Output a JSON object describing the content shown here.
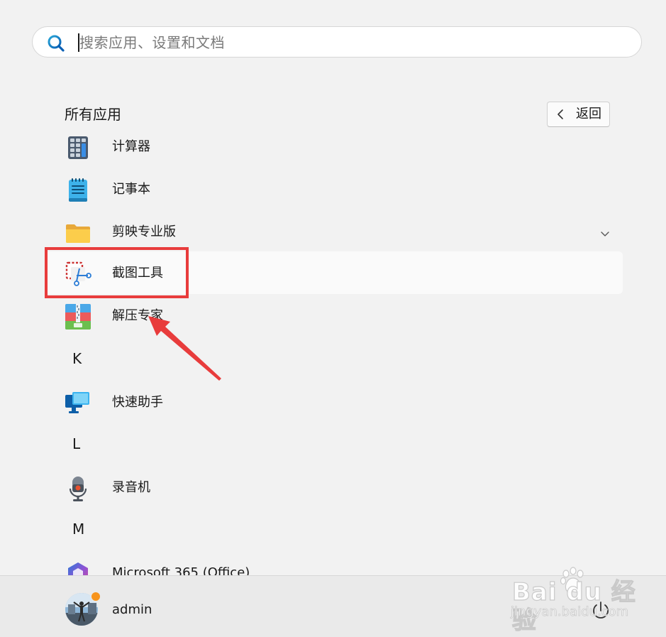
{
  "search": {
    "placeholder": "搜索应用、设置和文档"
  },
  "all_apps": {
    "title": "所有应用",
    "back_label": "返回"
  },
  "apps": [
    {
      "label": "计算器",
      "icon": "calculator-icon"
    },
    {
      "label": "记事本",
      "icon": "notepad-icon"
    },
    {
      "label": "剪映专业版",
      "icon": "folder-icon",
      "expandable": true
    },
    {
      "label": "截图工具",
      "icon": "snipping-tool-icon",
      "highlighted": true
    },
    {
      "label": "解压专家",
      "icon": "zip-archive-icon"
    },
    {
      "label": "快速助手",
      "icon": "quick-assist-icon"
    },
    {
      "label": "录音机",
      "icon": "voice-recorder-icon"
    },
    {
      "label": "Microsoft 365 (Office)",
      "icon": "microsoft-365-icon"
    }
  ],
  "letters": [
    "K",
    "L",
    "M"
  ],
  "user": {
    "name": "admin",
    "status_color": "#f7941d"
  },
  "annotation": {
    "color": "#e83c3c"
  },
  "watermark": {
    "brand": "Bai du 经验",
    "site": "jingyan.baidu.com"
  }
}
